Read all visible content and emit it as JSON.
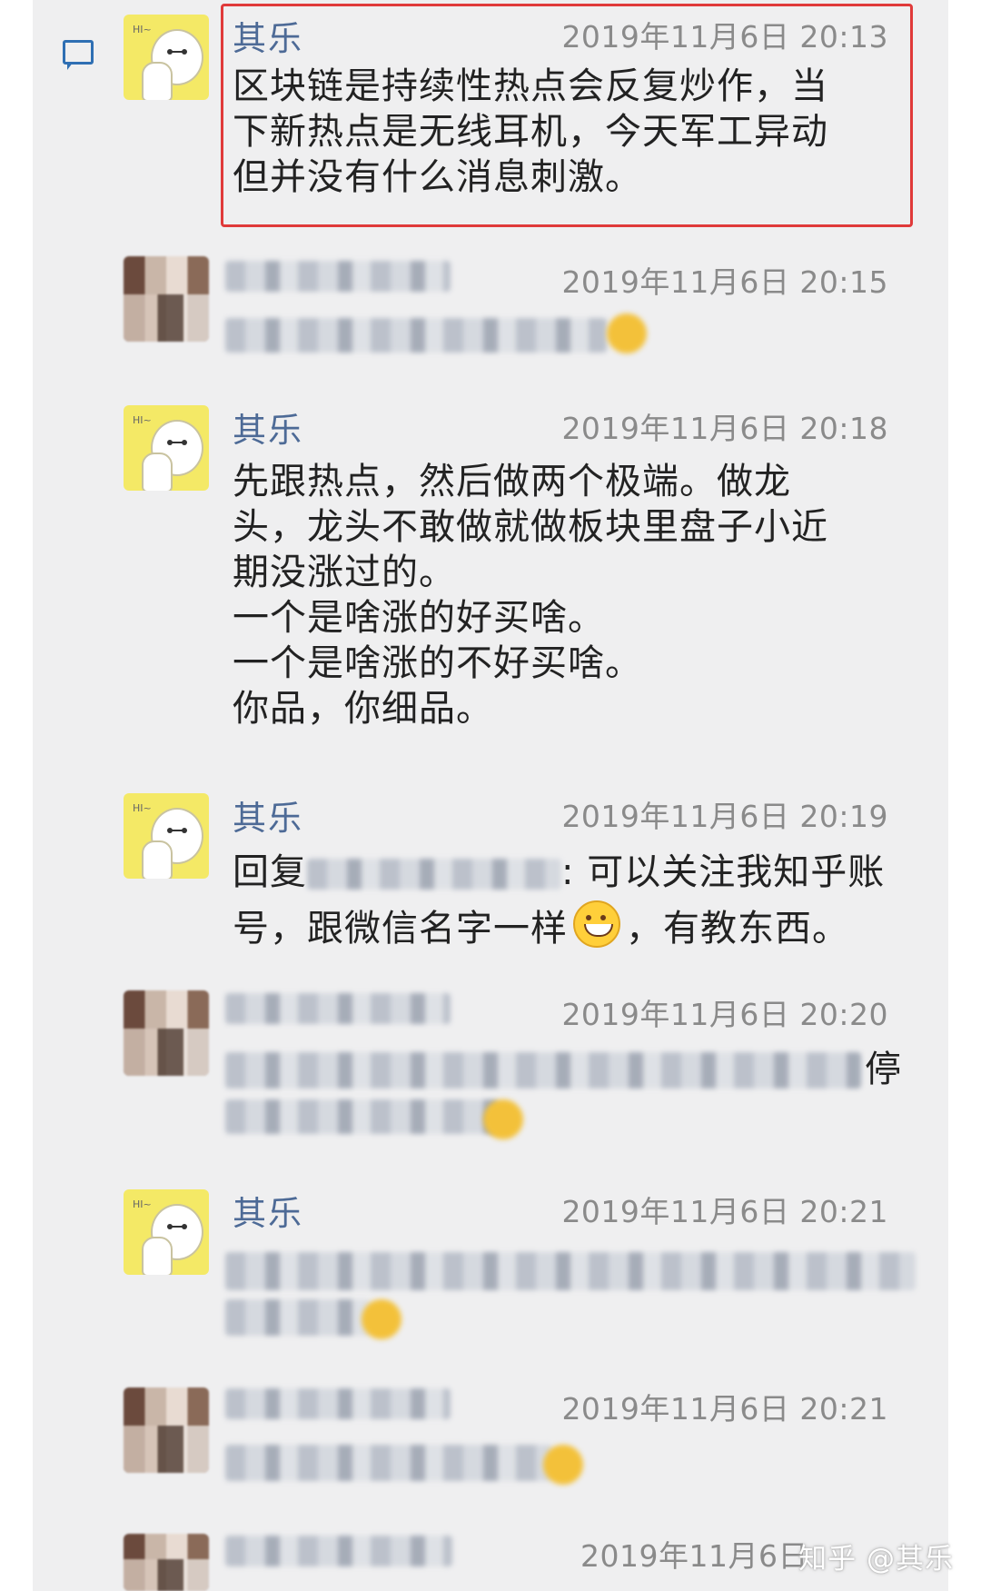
{
  "messages": [
    {
      "name": "其乐",
      "time": "2019年11月6日 20:13",
      "lines": [
        "区块链是持续性热点会反复炒作，当",
        "下新热点是无线耳机，今天军工异动",
        "但并没有什么消息刺激。"
      ],
      "highlighted": true
    },
    {
      "name": "",
      "time": "2019年11月6日 20:15",
      "lines": [],
      "blurred": true
    },
    {
      "name": "其乐",
      "time": "2019年11月6日 20:18",
      "lines": [
        "先跟热点，然后做两个极端。做龙",
        "头，龙头不敢做就做板块里盘子小近",
        "期没涨过的。",
        "一个是啥涨的好买啥。",
        "一个是啥涨的不好买啥。",
        "你品，你细品。"
      ]
    },
    {
      "name": "其乐",
      "time": "2019年11月6日 20:19",
      "reply_prefix": "回复",
      "reply_suffix": ": 可以关注我知乎账",
      "reply_line2_a": "号，跟微信名字一样",
      "reply_line2_b": "，有教东西。"
    },
    {
      "name": "",
      "time": "2019年11月6日 20:20",
      "lines": [],
      "blurred": true,
      "visible_fragment": "停"
    },
    {
      "name": "其乐",
      "time": "2019年11月6日 20:21",
      "lines": [],
      "blurred_text": true
    },
    {
      "name": "",
      "time": "2019年11月6日 20:21",
      "lines": [],
      "blurred": true
    },
    {
      "name": "",
      "time": "2019年11月6日",
      "lines": [],
      "blurred": true
    }
  ],
  "watermark": "知乎 @其乐",
  "colors": {
    "name": "#4d6a96",
    "highlight": "#e03a3a",
    "background": "#efeff0"
  },
  "icons": [
    "comment-icon",
    "avatar-baymax",
    "avatar-blurred",
    "grinning-emoji"
  ]
}
